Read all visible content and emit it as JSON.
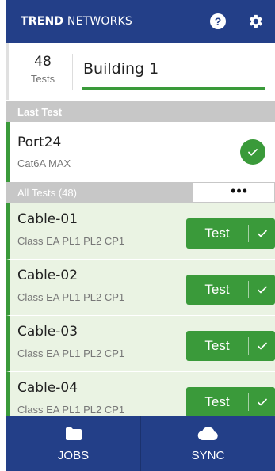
{
  "header": {
    "brand_bold": "TREND",
    "brand_light": "NETWORKS",
    "help_icon": "help-icon",
    "settings_icon": "gear-icon"
  },
  "summary": {
    "test_count": "48",
    "test_count_label": "Tests",
    "building": "Building 1"
  },
  "last_test": {
    "section_label": "Last Test",
    "name": "Port24",
    "standard": "Cat6A MAX",
    "status_icon": "check-icon"
  },
  "all_tests": {
    "section_label": "All Tests (48)",
    "more_label": "•••"
  },
  "cables": [
    {
      "name": "Cable-01",
      "spec": "Class EA PL1 PL2 CP1",
      "button": "Test"
    },
    {
      "name": "Cable-02",
      "spec": "Class EA PL1 PL2 CP1",
      "button": "Test"
    },
    {
      "name": "Cable-03",
      "spec": "Class EA PL1 PL2 CP1",
      "button": "Test"
    },
    {
      "name": "Cable-04",
      "spec": "Class EA PL1 PL2 CP1",
      "button": "Test"
    }
  ],
  "nav": {
    "jobs_label": "JOBS",
    "jobs_icon": "folder-icon",
    "sync_label": "SYNC",
    "sync_icon": "cloud-icon"
  },
  "colors": {
    "header_blue": "#233f88",
    "pass_green": "#3a9a3a",
    "row_green_bg": "#eaf3e3",
    "section_gray": "#c7c7c7"
  }
}
